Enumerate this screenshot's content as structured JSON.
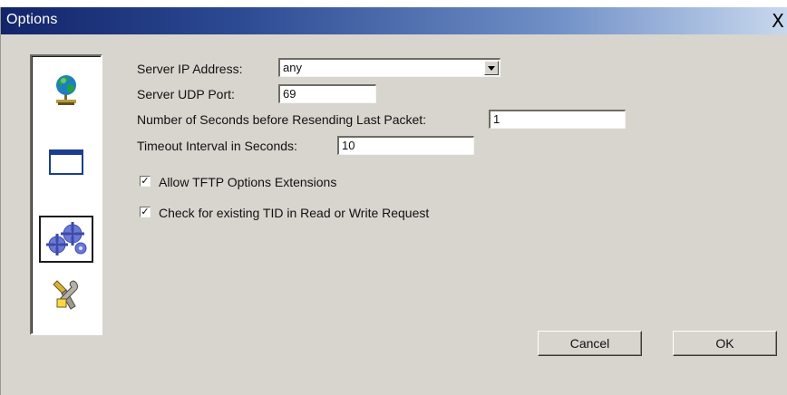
{
  "window": {
    "title": "Options",
    "close_glyph": "X"
  },
  "sidebar": {
    "items": [
      {
        "name": "network-globe-icon"
      },
      {
        "name": "window-icon"
      },
      {
        "name": "gears-icon",
        "selected": true
      },
      {
        "name": "tools-icon"
      }
    ]
  },
  "form": {
    "server_ip": {
      "label": "Server IP Address:",
      "value": "any"
    },
    "server_udp_port": {
      "label": "Server UDP Port:",
      "value": "69"
    },
    "resend_seconds": {
      "label": "Number of Seconds before Resending Last Packet:",
      "value": "1"
    },
    "timeout_interval": {
      "label": "Timeout Interval in Seconds:",
      "value": "10"
    },
    "allow_tftp_options": {
      "label": "Allow TFTP Options Extensions",
      "checked": true
    },
    "check_existing_tid": {
      "label": "Check for existing TID in Read or Write Request",
      "checked": true
    }
  },
  "buttons": {
    "cancel": "Cancel",
    "ok": "OK"
  }
}
